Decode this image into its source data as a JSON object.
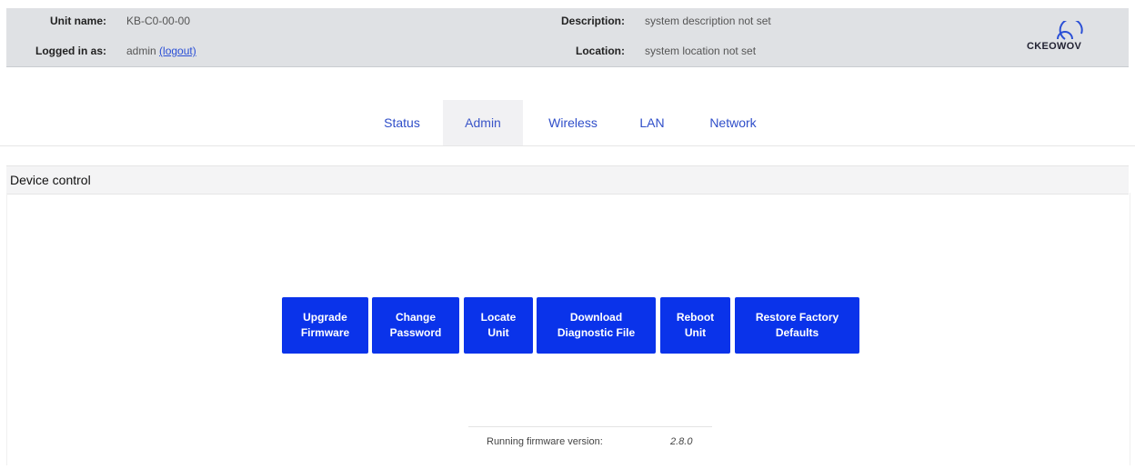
{
  "header": {
    "unit_name_label": "Unit name:",
    "unit_name": "KB-C0-00-00",
    "logged_in_label": "Logged in as:",
    "user": "admin",
    "logout_label": "(logout)",
    "description_label": "Description:",
    "description": "system description not set",
    "location_label": "Location:",
    "location": "system location not set",
    "logo_text": "CKEOWOV"
  },
  "tabs": [
    {
      "label": "Status",
      "active": false
    },
    {
      "label": "Admin",
      "active": true
    },
    {
      "label": "Wireless",
      "active": false
    },
    {
      "label": "LAN",
      "active": false
    },
    {
      "label": "Network",
      "active": false
    }
  ],
  "section": {
    "title": "Device control"
  },
  "buttons": [
    {
      "label": "Upgrade\nFirmware"
    },
    {
      "label": "Change\nPassword"
    },
    {
      "label": "Locate\nUnit"
    },
    {
      "label": "Download\nDiagnostic File"
    },
    {
      "label": "Reboot\nUnit"
    },
    {
      "label": "Restore Factory\nDefaults"
    }
  ],
  "firmware": {
    "label": "Running firmware version:",
    "version": "2.8.0"
  },
  "colors": {
    "button": "#0a33ea",
    "tab_text": "#2f4ec9",
    "header_bg": "#dfe1e4"
  }
}
